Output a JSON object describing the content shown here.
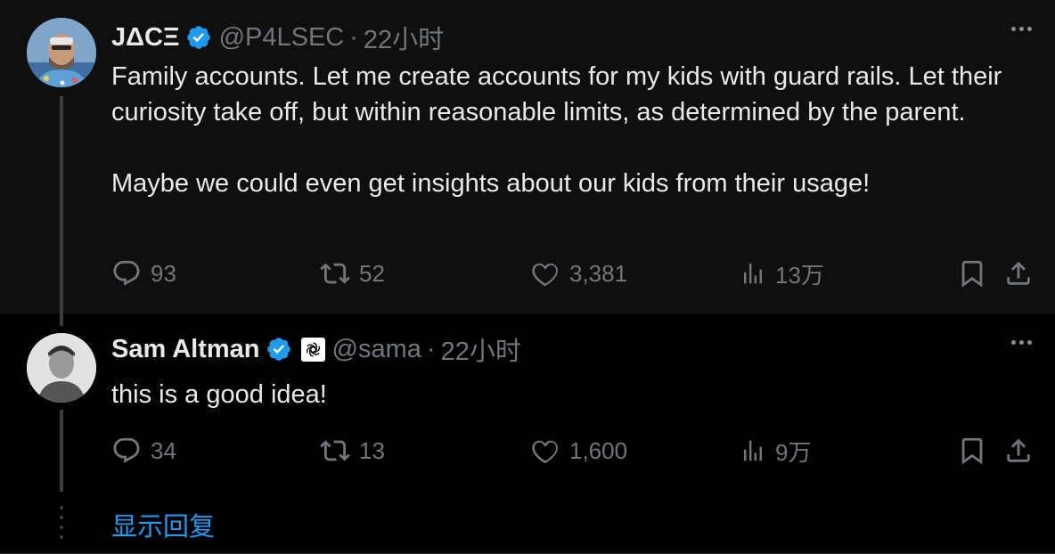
{
  "tweets": [
    {
      "author_name": "JΔCΞ",
      "handle": "@P4LSEC",
      "dot": "·",
      "time": "22小时",
      "paragraphs": [
        "Family accounts. Let me create accounts for my kids with guard rails. Let their curiosity take off, but within reasonable limits, as determined by the parent.",
        "Maybe we could even get insights about our kids from their usage!"
      ],
      "stats": {
        "replies": "93",
        "reposts": "52",
        "likes": "3,381",
        "views": "13万"
      }
    },
    {
      "author_name": "Sam Altman",
      "handle": "@sama",
      "dot": "·",
      "time": "22小时",
      "paragraphs": [
        "this is a good idea!"
      ],
      "stats": {
        "replies": "34",
        "reposts": "13",
        "likes": "1,600",
        "views": "9万"
      }
    }
  ],
  "show_replies_label": "显示回复",
  "colors": {
    "accent": "#1d9bf0",
    "muted": "#71767b",
    "text": "#e7e9ea",
    "verified": "#1d9bf0"
  },
  "icons": [
    "verified-badge-icon",
    "more-icon",
    "reply-icon",
    "repost-icon",
    "like-icon",
    "views-icon",
    "bookmark-icon",
    "share-icon",
    "openai-logo-icon"
  ]
}
